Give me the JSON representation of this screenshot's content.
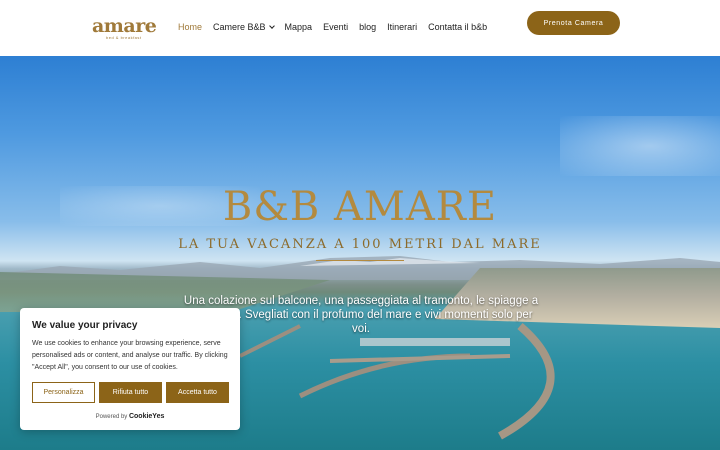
{
  "header": {
    "logo_text": "amare",
    "logo_subtext": "bed & breakfast",
    "nav": [
      {
        "label": "Home",
        "active": true
      },
      {
        "label": "Camere B&B",
        "dropdown": true
      },
      {
        "label": "Mappa"
      },
      {
        "label": "Eventi"
      },
      {
        "label": "blog"
      },
      {
        "label": "Itinerari"
      },
      {
        "label": "Contatta il b&b"
      }
    ],
    "cta_label": "Prenota Camera"
  },
  "hero": {
    "title": "B&B AMARE",
    "subtitle": "LA TUA VACANZA A 100 METRI DAL MARE",
    "text": "Una colazione sul balcone, una passeggiata al tramonto, le spiagge a due passi. Svegliati con il profumo del mare e vivi momenti solo per voi."
  },
  "cookie": {
    "title": "We value your privacy",
    "text": "We use cookies to enhance your browsing experience, serve personalised ads or content, and analyse our traffic. By clicking \"Accept All\", you consent to our use of cookies.",
    "btn_customize": "Personalizza",
    "btn_reject": "Rifiuta tutto",
    "btn_accept": "Accetta tutto",
    "powered_prefix": "Powered by",
    "powered_brand": "CookieYes"
  },
  "colors": {
    "accent": "#8c6418",
    "gold": "#b38a3f"
  }
}
